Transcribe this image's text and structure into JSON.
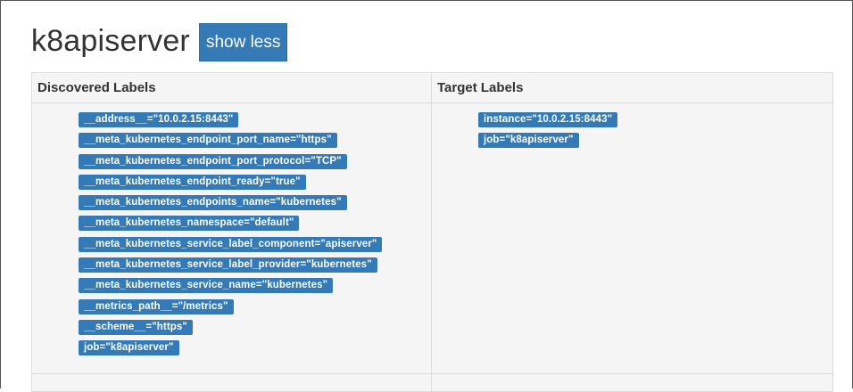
{
  "target": {
    "job_title": "k8apiserver",
    "toggle_label": "show less"
  },
  "table": {
    "headers": {
      "discovered": "Discovered Labels",
      "target": "Target Labels"
    },
    "discovered_labels": [
      "__address__=\"10.0.2.15:8443\"",
      "__meta_kubernetes_endpoint_port_name=\"https\"",
      "__meta_kubernetes_endpoint_port_protocol=\"TCP\"",
      "__meta_kubernetes_endpoint_ready=\"true\"",
      "__meta_kubernetes_endpoints_name=\"kubernetes\"",
      "__meta_kubernetes_namespace=\"default\"",
      "__meta_kubernetes_service_label_component=\"apiserver\"",
      "__meta_kubernetes_service_label_provider=\"kubernetes\"",
      "__meta_kubernetes_service_name=\"kubernetes\"",
      "__metrics_path__=\"/metrics\"",
      "__scheme__=\"https\"",
      "job=\"k8apiserver\""
    ],
    "target_labels": [
      "instance=\"10.0.2.15:8443\"",
      "job=\"k8apiserver\""
    ]
  },
  "colors": {
    "badge": "#337ab7",
    "cell_background": "#f5f5f5",
    "border": "#dddddd"
  }
}
